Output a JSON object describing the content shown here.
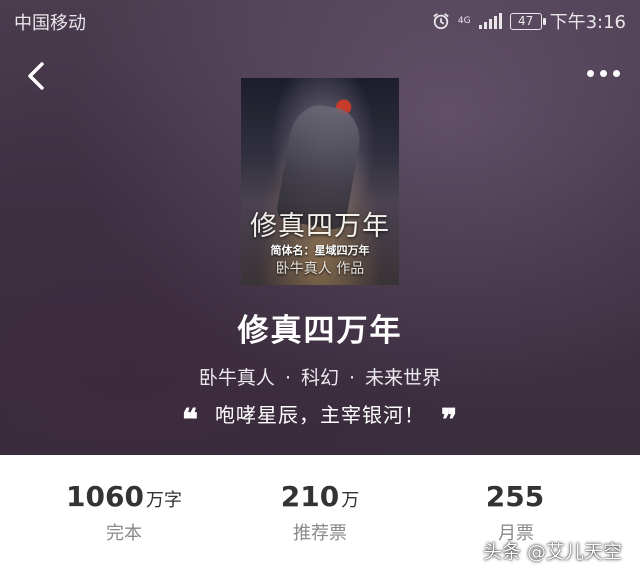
{
  "status_bar": {
    "carrier": "中国移动",
    "network": "4G",
    "battery": "47",
    "time": "下午3:16"
  },
  "nav": {
    "back_icon": "chevron-left-icon",
    "more_icon": "more-horizontal-icon"
  },
  "book": {
    "cover": {
      "title": "修真四万年",
      "subtitle": "简体名：星域四万年",
      "author_line": "卧牛真人 作品"
    },
    "title": "修真四万年",
    "author": "卧牛真人",
    "separator": "·",
    "genre": "科幻",
    "subgenre": "未来世界",
    "slogan": "咆哮星辰，主宰银河！",
    "quote_open": "❝",
    "quote_close": "❞"
  },
  "stats": [
    {
      "value": "1060",
      "unit": "万字",
      "label": "完本"
    },
    {
      "value": "210",
      "unit": "万",
      "label": "推荐票"
    },
    {
      "value": "255",
      "unit": "",
      "label": "月票"
    }
  ],
  "watermark": "头条 @艾儿天空"
}
